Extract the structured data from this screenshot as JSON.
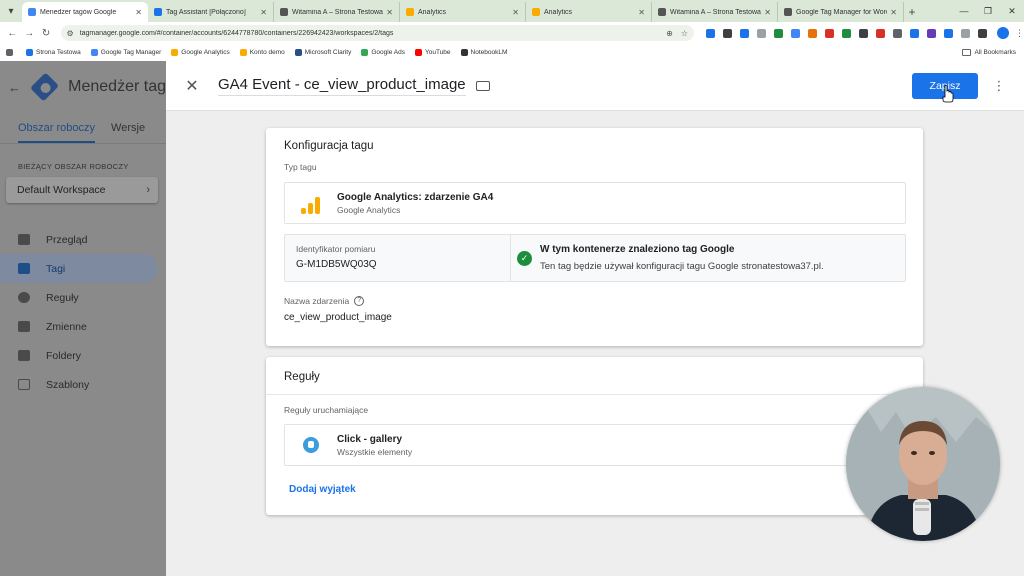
{
  "browser": {
    "tabs": [
      {
        "title": "Menedżer tagów Google",
        "color": "#4285f4",
        "active": true
      },
      {
        "title": "Tag Assistant [Połączono]",
        "color": "#1a73e8"
      },
      {
        "title": "Witamina A – Strona Testowa",
        "color": "#555555"
      },
      {
        "title": "Analytics",
        "color": "#f9ab00"
      },
      {
        "title": "Analytics",
        "color": "#f9ab00"
      },
      {
        "title": "Witamina A – Strona Testowa",
        "color": "#555555"
      },
      {
        "title": "Google Tag Manager for Word",
        "color": "#555555"
      }
    ],
    "url": "tagmanager.google.com/#/container/accounts/6244778780/containers/226942423/workspaces/2/tags",
    "bookmarks": [
      {
        "label": "Strona Testowa",
        "color": "#1a73e8"
      },
      {
        "label": "Google Tag Manager",
        "color": "#4285f4"
      },
      {
        "label": "Google Analytics",
        "color": "#f9ab00"
      },
      {
        "label": "Konto demo",
        "color": "#f9ab00"
      },
      {
        "label": "Microsoft Clarity",
        "color": "#2a4f86"
      },
      {
        "label": "Google Ads",
        "color": "#34a853"
      },
      {
        "label": "YouTube",
        "color": "#ff0000"
      },
      {
        "label": "NotebookLM",
        "color": "#333333"
      }
    ],
    "all_bookmarks": "All Bookmarks"
  },
  "sidebar": {
    "app_name": "Menedżer tag",
    "tab_workspace": "Obszar roboczy",
    "tab_versions": "Wersje",
    "workspace_label": "BIEŻĄCY OBSZAR ROBOCZY",
    "workspace_name": "Default Workspace",
    "nav": [
      {
        "label": "Przegląd"
      },
      {
        "label": "Tagi"
      },
      {
        "label": "Reguły"
      },
      {
        "label": "Zmienne"
      },
      {
        "label": "Foldery"
      },
      {
        "label": "Szablony"
      }
    ]
  },
  "panel": {
    "tag_name": "GA4 Event - ce_view_product_image",
    "save_label": "Zapisz",
    "config": {
      "title": "Konfiguracja tagu",
      "type_label": "Typ tagu",
      "type_name": "Google Analytics: zdarzenie GA4",
      "type_sub": "Google Analytics",
      "measurement_label": "Identyfikator pomiaru",
      "measurement_id": "G-M1DB5WQ03Q",
      "found_title": "W tym kontenerze znaleziono tag Google",
      "found_desc": "Ten tag będzie używał konfiguracji tagu Google stronatestowa37.pl.",
      "event_label": "Nazwa zdarzenia",
      "event_name": "ce_view_product_image"
    },
    "triggers": {
      "title": "Reguły",
      "firing_label": "Reguły uruchamiające",
      "trigger_name": "Click - gallery",
      "trigger_sub": "Wszystkie elementy",
      "add_exception": "Dodaj wyjątek"
    }
  }
}
